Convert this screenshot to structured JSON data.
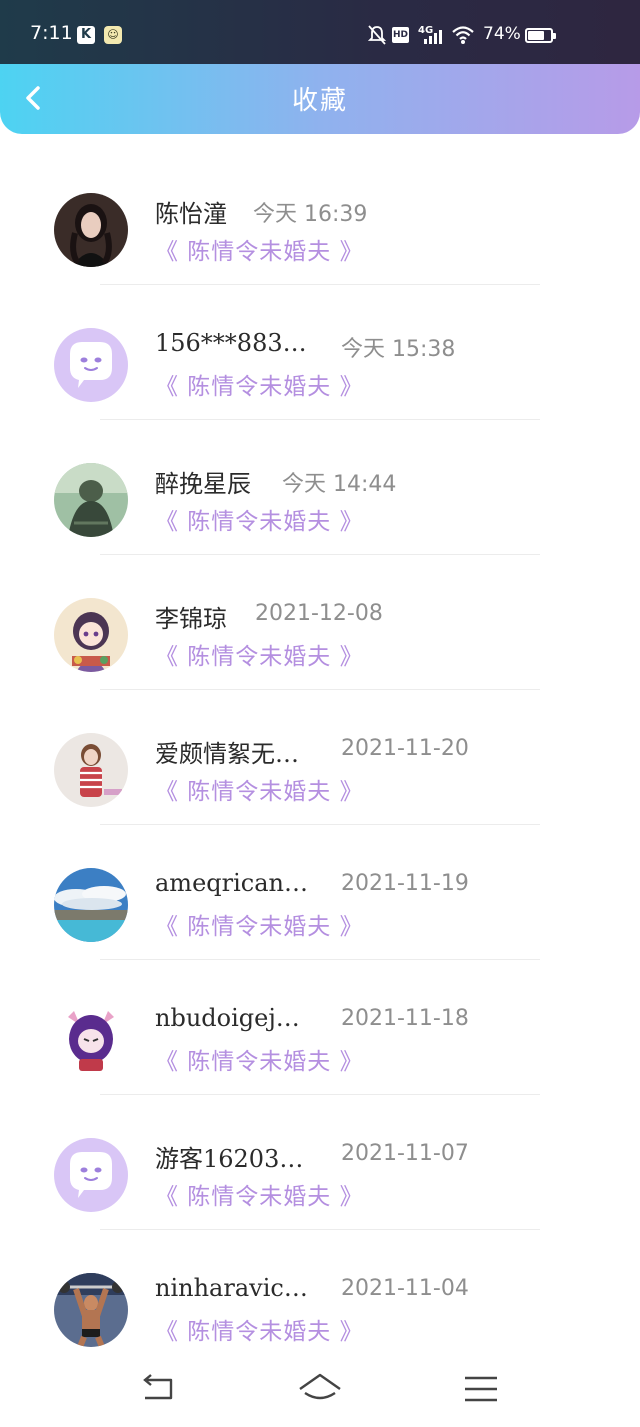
{
  "status_bar": {
    "time": "7:11",
    "app_icons": [
      "k-app-icon",
      "face-app-icon"
    ],
    "hd": "HD",
    "network": "4G",
    "battery_pct": "74%",
    "battery_level": 0.74
  },
  "header": {
    "title": "收藏",
    "back_icon": "chevron-left-icon"
  },
  "items": [
    {
      "name": "陈怡潼",
      "time": "今天 16:39",
      "novel": "《 陈情令未婚夫 》",
      "avatar": "photo-portrait-dark"
    },
    {
      "name": "156***883…",
      "time": "今天 15:38",
      "novel": "《 陈情令未婚夫 》",
      "avatar": "default-chat-avatar"
    },
    {
      "name": "醉挽星辰",
      "time": "今天 14:44",
      "novel": "《 陈情令未婚夫 》",
      "avatar": "photo-green-person"
    },
    {
      "name": "李锦琼",
      "time": "2021-12-08",
      "novel": "《 陈情令未婚夫 》",
      "avatar": "anime-girl-purple-hair"
    },
    {
      "name": "爱颇情絮无…",
      "time": "2021-11-20",
      "novel": "《 陈情令未婚夫 》",
      "avatar": "photo-girl-striped"
    },
    {
      "name": "ameqrican…",
      "time": "2021-11-19",
      "novel": "《 陈情令未婚夫 》",
      "avatar": "photo-sky-lake"
    },
    {
      "name": "nbudoigej…",
      "time": "2021-11-18",
      "novel": "《 陈情令未婚夫 》",
      "avatar": "anime-purple-character"
    },
    {
      "name": "游客16203…",
      "time": "2021-11-07",
      "novel": "《 陈情令未婚夫 》",
      "avatar": "default-chat-avatar"
    },
    {
      "name": "ninharavic…",
      "time": "2021-11-04",
      "novel": "《 陈情令未婚夫 》",
      "avatar": "photo-athlete"
    }
  ],
  "nav": {
    "back": "back-nav-icon",
    "home": "home-nav-icon",
    "menu": "menu-nav-icon"
  },
  "colors": {
    "header_start": "#4dd3f2",
    "header_end": "#b79be8",
    "novel_text": "#b48fe0",
    "default_avatar": "#d9c6f6"
  }
}
